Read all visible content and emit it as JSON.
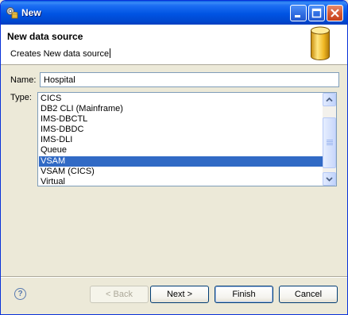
{
  "window": {
    "title": "New",
    "icons": {
      "app": "gear-database-icon",
      "minimize": "minimize-icon",
      "maximize": "maximize-icon",
      "close": "close-icon"
    }
  },
  "header": {
    "title": "New data source",
    "description": "Creates New data source",
    "icon": "database-cylinder-icon"
  },
  "form": {
    "name_label": "Name:",
    "name_value": "Hospital",
    "type_label": "Type:",
    "type_options": [
      {
        "label": "CICS",
        "selected": false
      },
      {
        "label": "DB2 CLI (Mainframe)",
        "selected": false
      },
      {
        "label": "IMS-DBCTL",
        "selected": false
      },
      {
        "label": "IMS-DBDC",
        "selected": false
      },
      {
        "label": "IMS-DLI",
        "selected": false
      },
      {
        "label": "Queue",
        "selected": false
      },
      {
        "label": "VSAM",
        "selected": true
      },
      {
        "label": "VSAM (CICS)",
        "selected": false
      },
      {
        "label": "Virtual",
        "selected": false
      }
    ]
  },
  "footer": {
    "help_label": "?",
    "back_label": "< Back",
    "next_label": "Next >",
    "finish_label": "Finish",
    "cancel_label": "Cancel"
  },
  "colors": {
    "titlebar": "#0054e3",
    "selection": "#316ac5",
    "dialog_bg": "#ece9d8"
  }
}
